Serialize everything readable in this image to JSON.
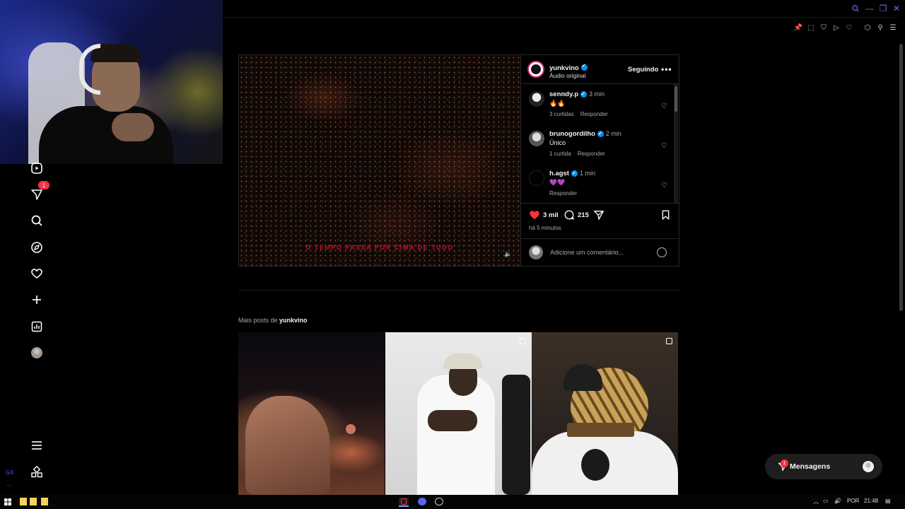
{
  "left_nav": {
    "items": [
      {
        "name": "reels",
        "icon": "reels-icon"
      },
      {
        "name": "messages",
        "icon": "send-icon",
        "badge": "1"
      },
      {
        "name": "search",
        "icon": "search-icon"
      },
      {
        "name": "explore",
        "icon": "compass-icon"
      },
      {
        "name": "notifications",
        "icon": "heart-icon"
      },
      {
        "name": "create",
        "icon": "plus-icon"
      },
      {
        "name": "dashboard",
        "icon": "chart-icon"
      },
      {
        "name": "profile",
        "icon": "avatar"
      }
    ],
    "more_icon": "menu-icon",
    "threads_icon": "threads-icon"
  },
  "opera_gx": {
    "label": "GX",
    "dots": "···"
  },
  "post": {
    "overlay_text": "O TEMPO PASSA POR CIMA DE TUDO",
    "author": "yunkvino",
    "audio": "Áudio original",
    "follow_label": "Seguindo",
    "more": "•••",
    "comments": [
      {
        "user": "senndy.p",
        "time": "3 min",
        "text": "🔥🔥",
        "likes": "3 curtidas",
        "reply": "Responder"
      },
      {
        "user": "brunogordilho",
        "time": "2 min",
        "text": "Único",
        "likes": "1 curtida",
        "reply": "Responder"
      },
      {
        "user": "h.agst",
        "time": "1 min",
        "text": "💜💜",
        "likes": "",
        "reply": "Responder"
      }
    ],
    "likes_count": "3 mil",
    "comments_count": "215",
    "time_ago": "há 5 minutos",
    "add_comment_placeholder": "Adicione um comentário..."
  },
  "more_posts": {
    "prefix": "Mais posts de",
    "user": "yunkvino"
  },
  "messages_pill": {
    "label": "Mensagens",
    "badge": "1"
  },
  "taskbar": {
    "lang": "POR",
    "clock": "21:48"
  },
  "colors": {
    "accent": "#0095f6",
    "like": "#ff3040",
    "opera": "#6a6aff"
  }
}
